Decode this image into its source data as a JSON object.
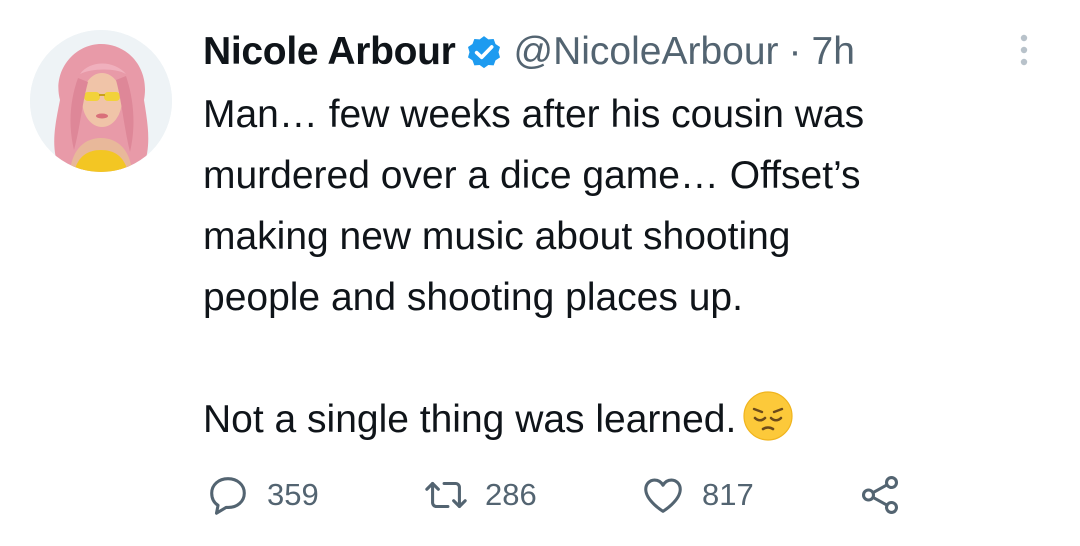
{
  "tweet": {
    "author": {
      "display_name": "Nicole Arbour",
      "handle": "@NicoleArbour",
      "verified": true
    },
    "separator": "·",
    "time": "7h",
    "text_lines": [
      "Man… few weeks after his cousin was",
      "murdered over a dice game… Offset’s",
      "making new music about shooting",
      "people and shooting places up."
    ],
    "text_final": "Not a single thing was learned.",
    "emoji": "pensive-face-emoji",
    "stats": {
      "replies": "359",
      "retweets": "286",
      "likes": "817"
    }
  },
  "icons": {
    "reply": "reply-icon",
    "retweet": "retweet-icon",
    "like": "heart-icon",
    "share": "share-icon",
    "more": "more-vertical-icon",
    "verified": "verified-badge-icon"
  },
  "colors": {
    "text_primary": "#0f1419",
    "text_secondary": "#536471",
    "verified_blue": "#1d9bf0",
    "background": "#ffffff"
  }
}
